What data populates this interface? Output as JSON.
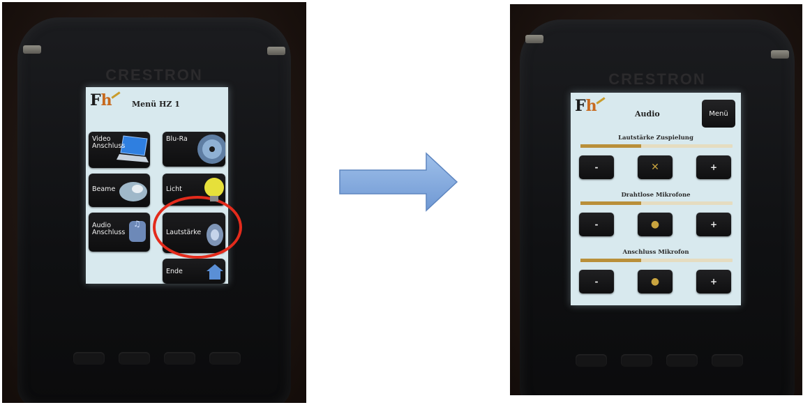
{
  "brand": "CRESTRON",
  "logo": {
    "f": "F",
    "h": "h"
  },
  "left_panel": {
    "title": "Menü HZ 1",
    "tiles": [
      {
        "label": "Video\nAnschluss",
        "icon": "laptop-icon"
      },
      {
        "label": "Blu-Ra",
        "icon": "disc-icon"
      },
      {
        "label": "Beame",
        "icon": "projector-icon"
      },
      {
        "label": "Licht",
        "icon": "bulb-icon"
      },
      {
        "label": "Audio\nAnschluss",
        "icon": "music-icon"
      },
      {
        "label": "Lautstärke",
        "icon": "speaker-icon"
      },
      {
        "label": "Ende",
        "icon": "home-icon"
      }
    ],
    "highlighted_tile": "Lautstärke"
  },
  "right_panel": {
    "title": "Audio",
    "menu_label": "Menü",
    "sections": [
      {
        "label": "Lautstärke Zuspielung",
        "level": 0.4,
        "minus": "-",
        "plus": "+",
        "center_icon": "mute-icon"
      },
      {
        "label": "Drahtlose Mikrofone",
        "level": 0.4,
        "minus": "-",
        "plus": "+",
        "center_icon": "mic-icon"
      },
      {
        "label": "Anschluss Mikrofon",
        "level": 0.4,
        "minus": "-",
        "plus": "+",
        "center_icon": "mic-icon"
      }
    ]
  },
  "colors": {
    "accent": "#b98f39",
    "arrow": "#7aa5dc",
    "highlight": "#e32b1c",
    "screen": "#d8e9ee"
  }
}
